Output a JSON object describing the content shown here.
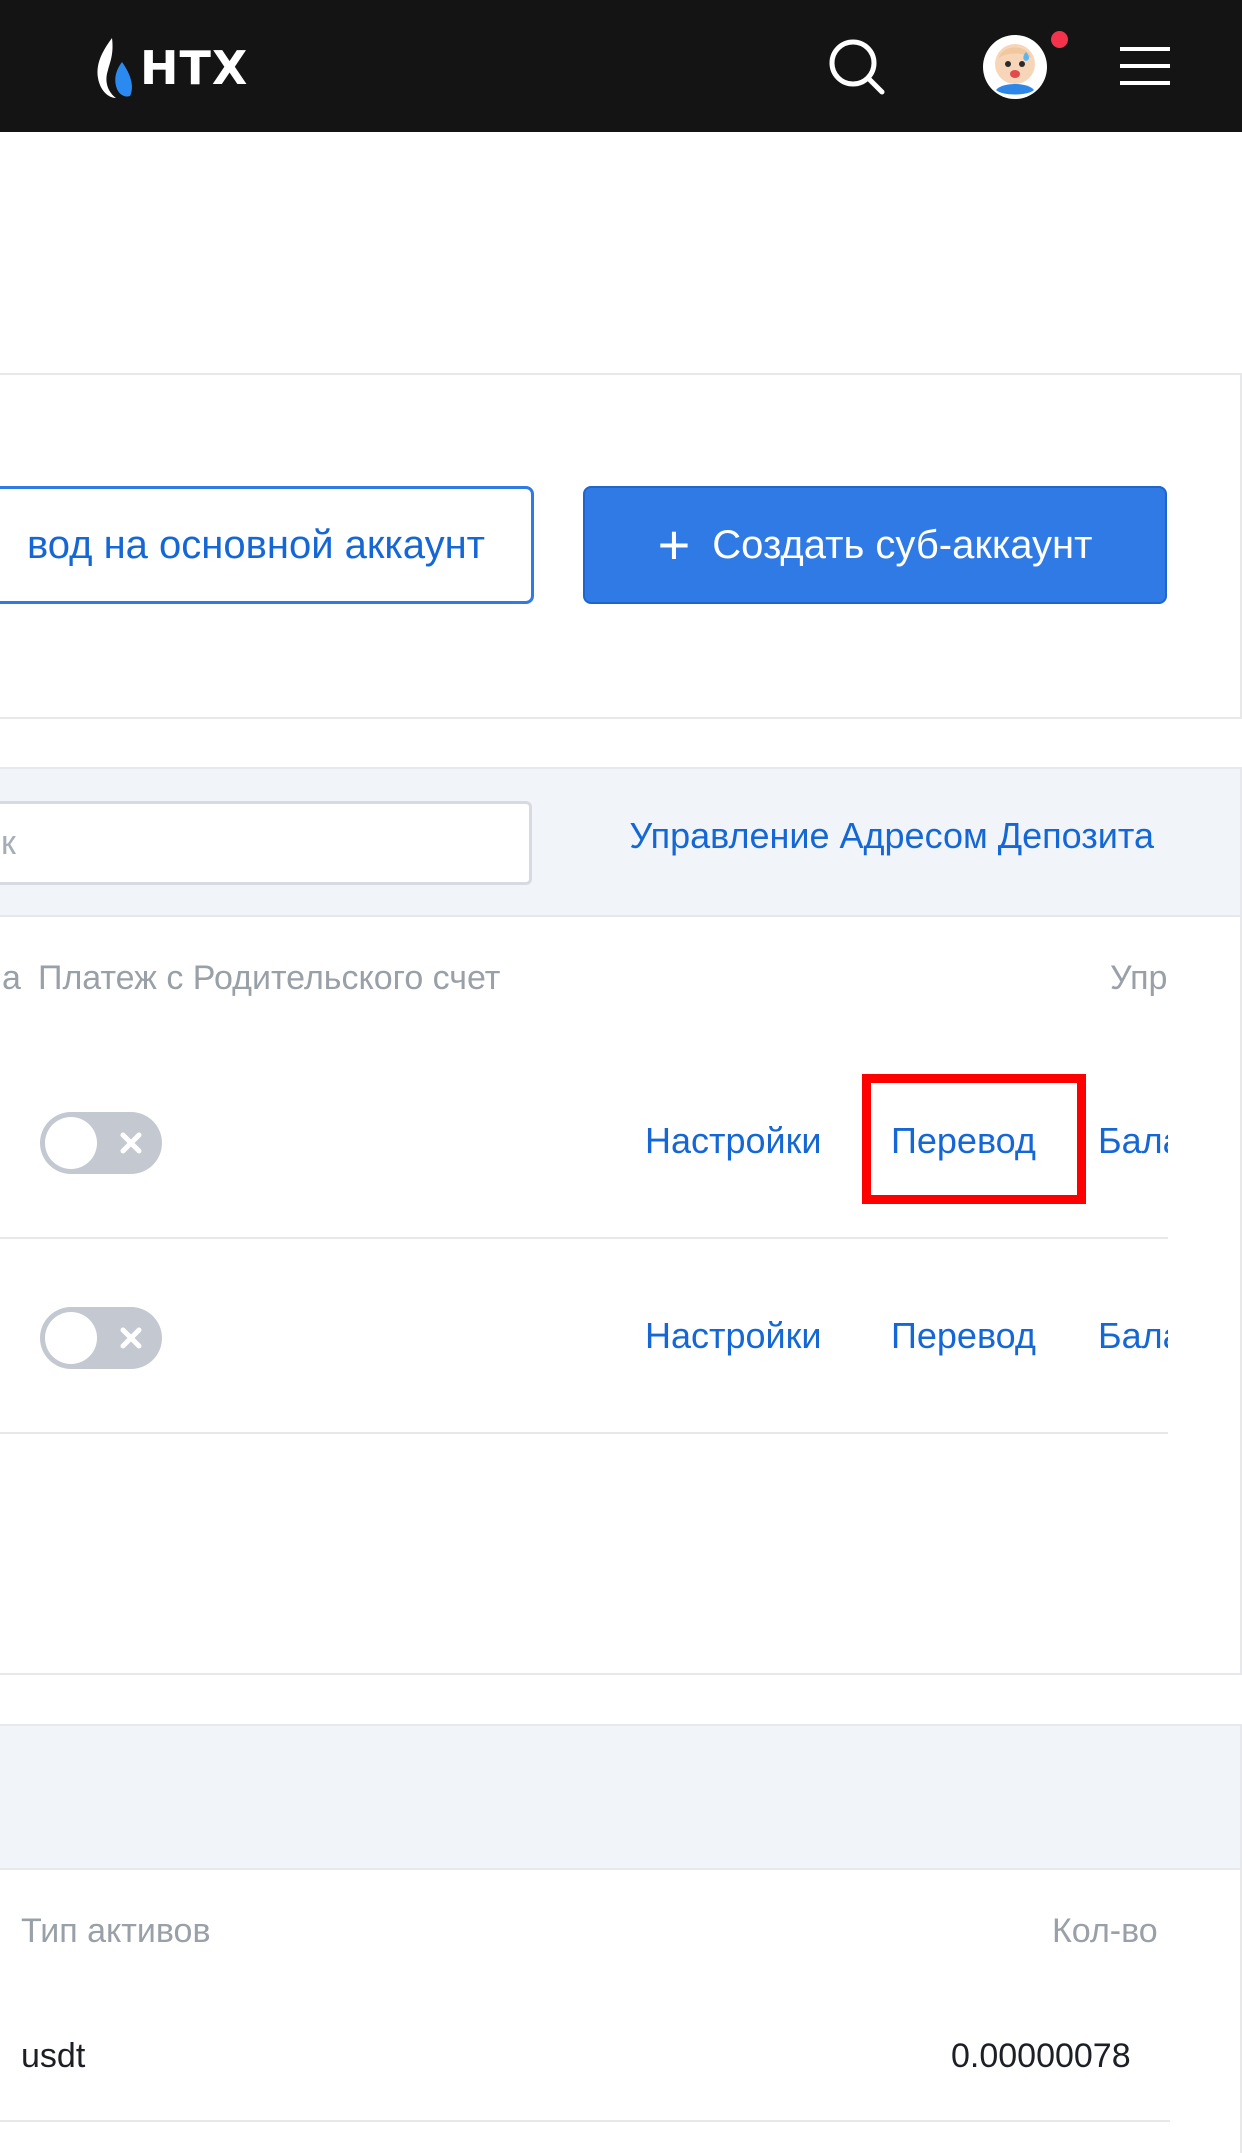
{
  "header": {
    "logo_text": "HTX",
    "icons": [
      "htx-flame-icon",
      "search-icon",
      "avatar",
      "hamburger-menu-icon"
    ],
    "notification_dot_color": "#f5324b"
  },
  "actions": {
    "transfer_main_label": "вод на основной аккаунт",
    "create_sub_label": "Создать суб-аккаунт",
    "create_sub_icon": "plus-icon"
  },
  "subaccounts": {
    "search_placeholder": "к",
    "deposit_address_link": "Управление Адресом Депозита",
    "columns": {
      "left_partial": "а",
      "parent_payment": "Платеж с Родительского счет",
      "manage_partial": "Упр"
    },
    "rows": [
      {
        "toggle_on": false,
        "settings": "Настройки",
        "transfer": "Перевод",
        "balance_partial": "Бала"
      },
      {
        "toggle_on": false,
        "settings": "Настройки",
        "transfer": "Перевод",
        "balance_partial": "Бала"
      }
    ]
  },
  "assets": {
    "columns": {
      "asset_type": "Тип активов",
      "amount": "Кол-во"
    },
    "rows": [
      {
        "asset": "usdt",
        "amount": "0.00000078"
      }
    ]
  },
  "colors": {
    "brand_blue": "#2f7ae5",
    "link_blue": "#1467d4",
    "header_bg": "#141414",
    "highlight_red": "#ff0000"
  }
}
